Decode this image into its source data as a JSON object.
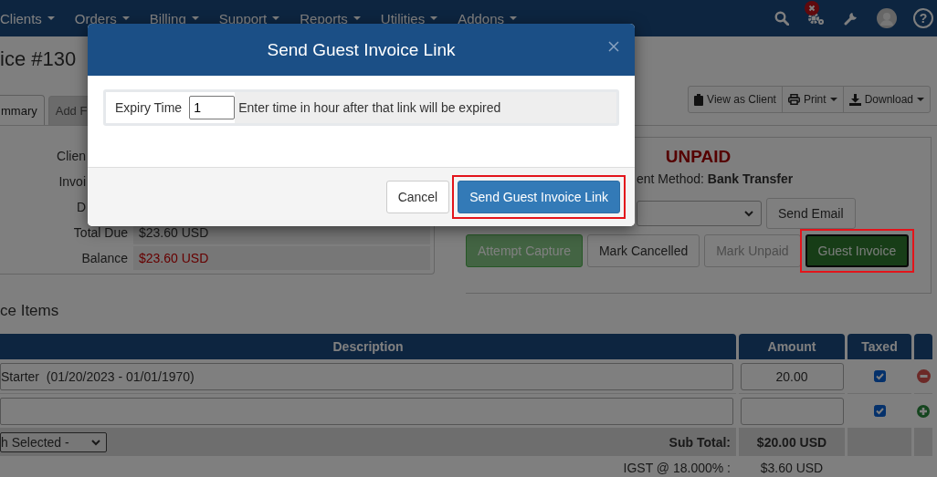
{
  "nav": {
    "items": [
      "Clients",
      "Orders",
      "Billing",
      "Support",
      "Reports",
      "Utilities",
      "Addons"
    ],
    "help_glyph": "?"
  },
  "page": {
    "title": "ice #130",
    "tabs": [
      {
        "label": "mmary",
        "selected": true
      },
      {
        "label": "Add F",
        "selected": false
      }
    ],
    "actions": [
      {
        "label": "View as Client",
        "kind": "clipboard",
        "dropdown": false
      },
      {
        "label": "Print",
        "kind": "print",
        "dropdown": true
      },
      {
        "label": "Download",
        "kind": "download",
        "dropdown": true
      }
    ]
  },
  "summary": [
    {
      "label": "Clien"
    },
    {
      "label": "Invoi"
    },
    {
      "label": "D"
    },
    {
      "label": "Total Due",
      "value": "$23.60 USD",
      "kind": "plain"
    },
    {
      "label": "Balance",
      "value": "$23.60 USD",
      "kind": "due"
    }
  ],
  "status": {
    "label": "UNPAID",
    "payment_method": "ent Method: **Bank Transfer**",
    "email_button": "Send Email",
    "buttons": [
      {
        "label": "Attempt Capture",
        "kind": "success",
        "disabled": true
      },
      {
        "label": "Mark Cancelled",
        "kind": "default",
        "disabled": false
      },
      {
        "label": "Mark Unpaid",
        "kind": "default",
        "disabled": true
      },
      {
        "label": "Guest Invoice",
        "kind": "dark-success",
        "disabled": false,
        "highlighted": true
      }
    ]
  },
  "items": {
    "heading": "ce Items",
    "columns": [
      "Description",
      "Amount",
      "Taxed"
    ],
    "rows": [
      {
        "description": "Starter  (01/20/2023 - 01/01/1970)",
        "amount": "20.00",
        "taxed": true,
        "kind": "remove"
      },
      {
        "taxed": true,
        "kind": "add"
      }
    ],
    "bulk_select": "h Selected -",
    "totals": [
      {
        "label": "Sub Total:",
        "value": "$20.00 USD",
        "kind": "bold"
      },
      {
        "label": "IGST @ 18.000% :",
        "value": "$3.60 USD",
        "kind": "plain"
      }
    ]
  },
  "modal": {
    "title": "Send Guest Invoice Link",
    "field_label": "Expiry Time",
    "value": "1",
    "help": "Enter time in hour after that link will be expired",
    "buttons": [
      {
        "label": "Cancel",
        "kind": "default"
      },
      {
        "label": "Send Guest Invoice Link",
        "kind": "primary",
        "highlighted": true
      }
    ]
  }
}
